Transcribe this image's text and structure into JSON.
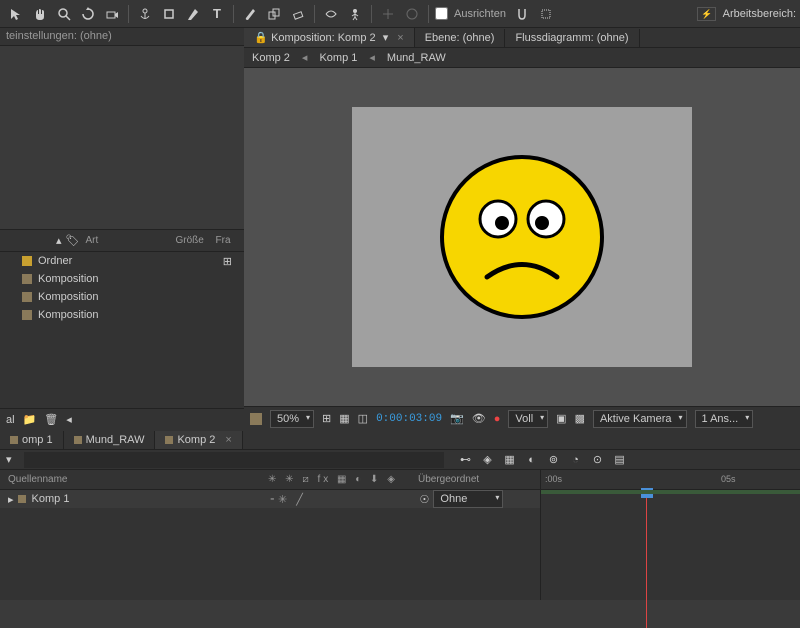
{
  "toolbar": {
    "align_label": "Ausrichten",
    "workspace_label": "Arbeitsbereich:"
  },
  "left": {
    "settings_title": "teinstellungen: (ohne)",
    "col_art": "Art",
    "col_size": "Größe",
    "col_fr": "Fra",
    "items": [
      {
        "label": "Ordner",
        "color": "#c8a030"
      },
      {
        "label": "Komposition",
        "color": "#8a7a5a"
      },
      {
        "label": "Komposition",
        "color": "#8a7a5a"
      },
      {
        "label": "Komposition",
        "color": "#8a7a5a"
      }
    ],
    "footer_label": "al"
  },
  "comp_panel": {
    "tabs": [
      {
        "label": "Komposition: Komp 2",
        "active": true,
        "closable": true,
        "lock": true
      },
      {
        "label": "Ebene: (ohne)",
        "active": false
      },
      {
        "label": "Flussdiagramm: (ohne)",
        "active": false
      }
    ],
    "breadcrumb": [
      "Komp 2",
      "Komp 1",
      "Mund_RAW"
    ],
    "zoom": "50%",
    "timecode": "0:00:03:09",
    "quality": "Voll",
    "camera": "Aktive Kamera",
    "views": "1 Ans..."
  },
  "timeline": {
    "tabs": [
      {
        "label": "omp 1",
        "color": "#8a7a5a",
        "active": false
      },
      {
        "label": "Mund_RAW",
        "color": "#8a7a5a",
        "active": false
      },
      {
        "label": "Komp 2",
        "color": "#8a7a5a",
        "active": true,
        "closable": true
      }
    ],
    "col_source": "Quellenname",
    "col_parent": "Übergeordnet",
    "layer": {
      "name": "Komp 1",
      "parent": "Ohne"
    },
    "ruler": {
      "t0": ":00s",
      "t1": "05s"
    }
  },
  "colors": {
    "smiley": "#f7d600",
    "canvas": "#a0a0a0"
  }
}
